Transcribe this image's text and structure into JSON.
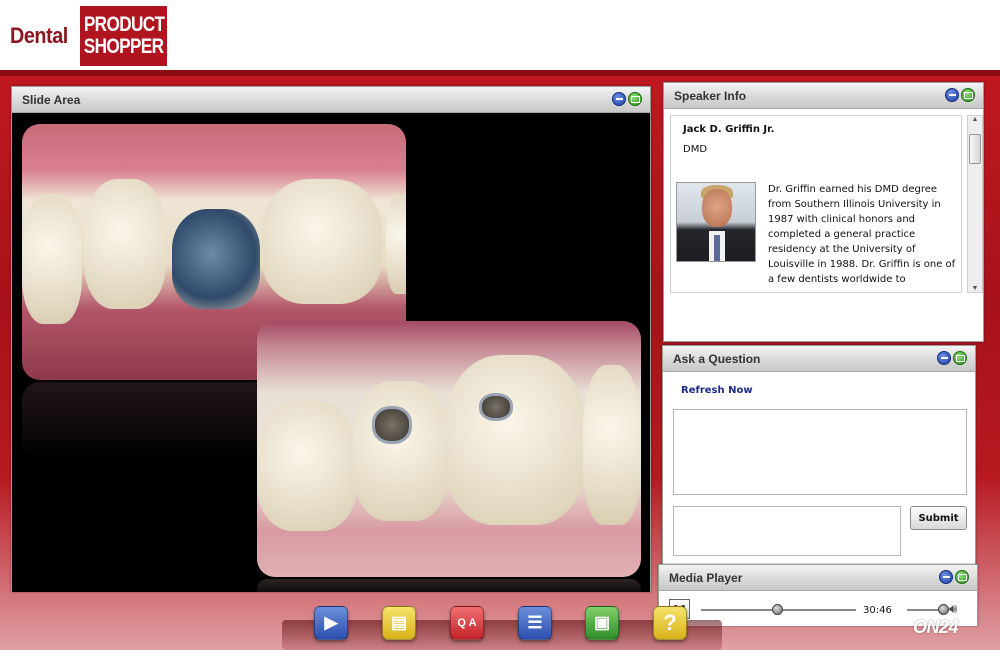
{
  "logo": {
    "word1": "Dental",
    "word2": "PRODUCT",
    "word3": "SHOPPER"
  },
  "slide_area": {
    "title": "Slide Area"
  },
  "speaker_info": {
    "title": "Speaker Info",
    "name": "Jack D. Griffin Jr.",
    "degree": "DMD",
    "bio": "Dr. Griffin earned his DMD degree from Southern Illinois University in 1987 with clinical honors and completed a general practice residency at the University of Louisville in 1988. Dr. Griffin is one of a few dentists worldwide to"
  },
  "ask_question": {
    "title": "Ask a Question",
    "refresh_label": "Refresh Now",
    "submit_label": "Submit"
  },
  "media_player": {
    "title": "Media Player",
    "time": "30:46",
    "progress_fraction": 0.49,
    "volume_fraction": 0.9
  },
  "branding": {
    "on24": "ON24"
  },
  "toolbar": {
    "icons": [
      "video-icon",
      "slides-icon",
      "qa-icon",
      "speaker-bio-icon",
      "resources-icon",
      "help-icon"
    ],
    "help_glyph": "?"
  },
  "colors": {
    "brand_red": "#b0141e",
    "stage_red": "#c01820",
    "link_blue": "#1a2a8a"
  }
}
